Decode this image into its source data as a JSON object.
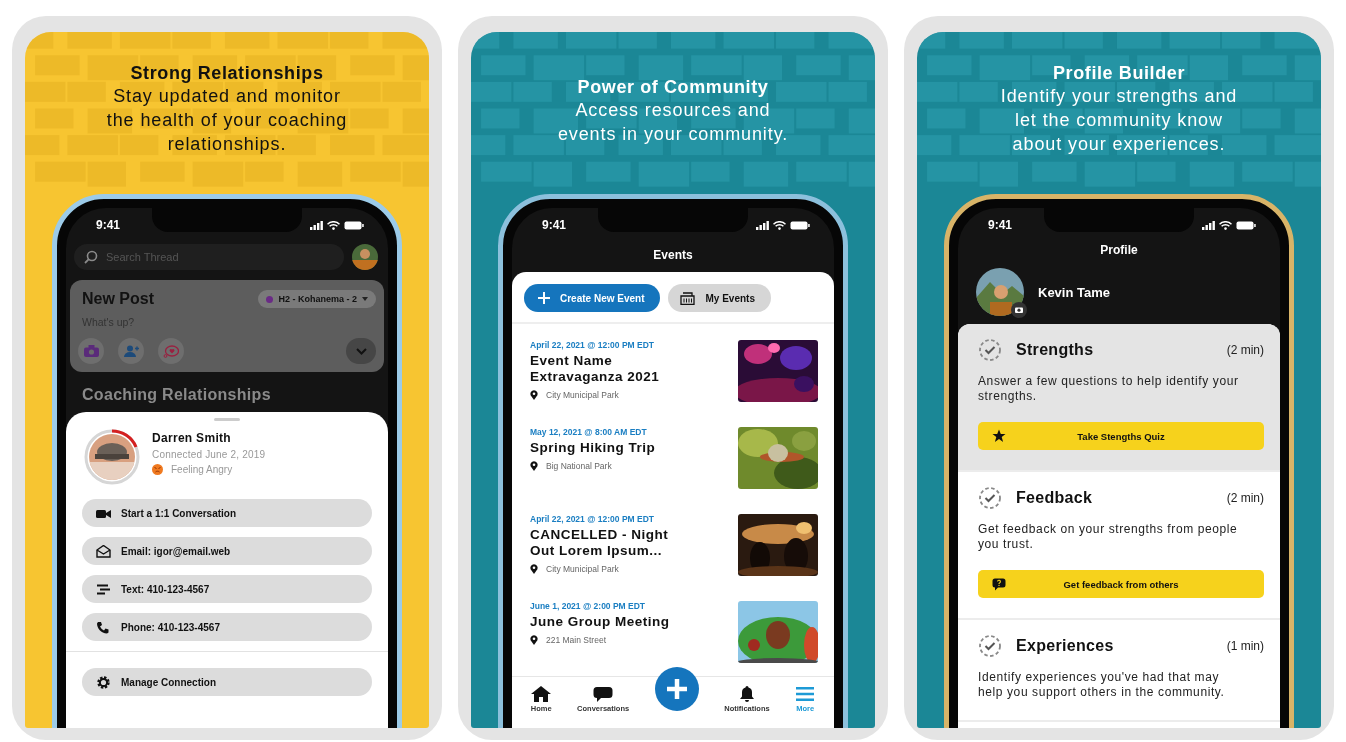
{
  "relationships_panel": {
    "title": "Strong Relationships",
    "subtitle_lines": [
      "Stay updated and monitor",
      "the health of your coaching",
      "relationships."
    ],
    "time": "9:41",
    "search": {
      "placeholder": "Search Thread"
    },
    "new_post": {
      "title": "New Post",
      "group": "H2 - Kohanema - 2",
      "placeholder": "What's up?"
    },
    "section_title": "Coaching Relationships",
    "contact": {
      "name": "Darren Smith",
      "connected": "Connected June 2, 2019",
      "mood": "Feeling Angry",
      "actions": [
        {
          "kind": "video",
          "label": "Start a 1:1 Conversation"
        },
        {
          "kind": "email",
          "label": "Email: igor@email.web"
        },
        {
          "kind": "text",
          "label": "Text: 410-123-4567"
        },
        {
          "kind": "phone",
          "label": "Phone: 410-123-4567"
        }
      ],
      "manage": "Manage Connection"
    }
  },
  "community_panel": {
    "title": "Power of Community",
    "subtitle_lines": [
      "Access resources and",
      "events in your community."
    ],
    "time": "9:41",
    "screen_title": "Events",
    "create_button": "Create New Event",
    "my_events_button": "My Events",
    "events": [
      {
        "date": "April 22, 2021 @ 12:00 PM EDT",
        "name": "Event Name Extravaganza 2021",
        "location": "City Municipal Park"
      },
      {
        "date": "May 12, 2021 @ 8:00 AM EDT",
        "name": "Spring Hiking Trip",
        "location": "Big National Park"
      },
      {
        "date": "April 22, 2021 @ 12:00 PM EDT",
        "name": "CANCELLED - Night Out Lorem Ipsum...",
        "location": "City Municipal Park"
      },
      {
        "date": "June 1, 2021 @ 2:00 PM EDT",
        "name": "June Group Meeting",
        "location": "221 Main Street"
      }
    ],
    "tabs": [
      {
        "kind": "home",
        "label": "Home",
        "selected": false
      },
      {
        "kind": "chat",
        "label": "Conversations",
        "selected": false
      },
      {
        "kind": "bell",
        "label": "Notifications",
        "selected": false
      },
      {
        "kind": "menu",
        "label": "More",
        "selected": true
      }
    ]
  },
  "profile_panel": {
    "title": "Profile Builder",
    "subtitle_lines": [
      "Identify your strengths and",
      "let the community know",
      "about your experiences."
    ],
    "time": "9:41",
    "screen_title": "Profile",
    "name": "Kevin Tame",
    "sections": [
      {
        "title": "Strengths",
        "duration": "(2 min)",
        "description": "Answer a few questions to help identify your strengths.",
        "selected": true,
        "button": {
          "kind": "star",
          "label": "Take Stengths Quiz"
        }
      },
      {
        "title": "Feedback",
        "duration": "(2 min)",
        "description": "Get feedback on your strengths from people you trust.",
        "selected": false,
        "button": {
          "kind": "question",
          "label": "Get feedback from others"
        }
      },
      {
        "title": "Experiences",
        "duration": "(1 min)",
        "description": "Identify experiences you've had that may help you support others in the community.",
        "selected": false
      }
    ]
  }
}
